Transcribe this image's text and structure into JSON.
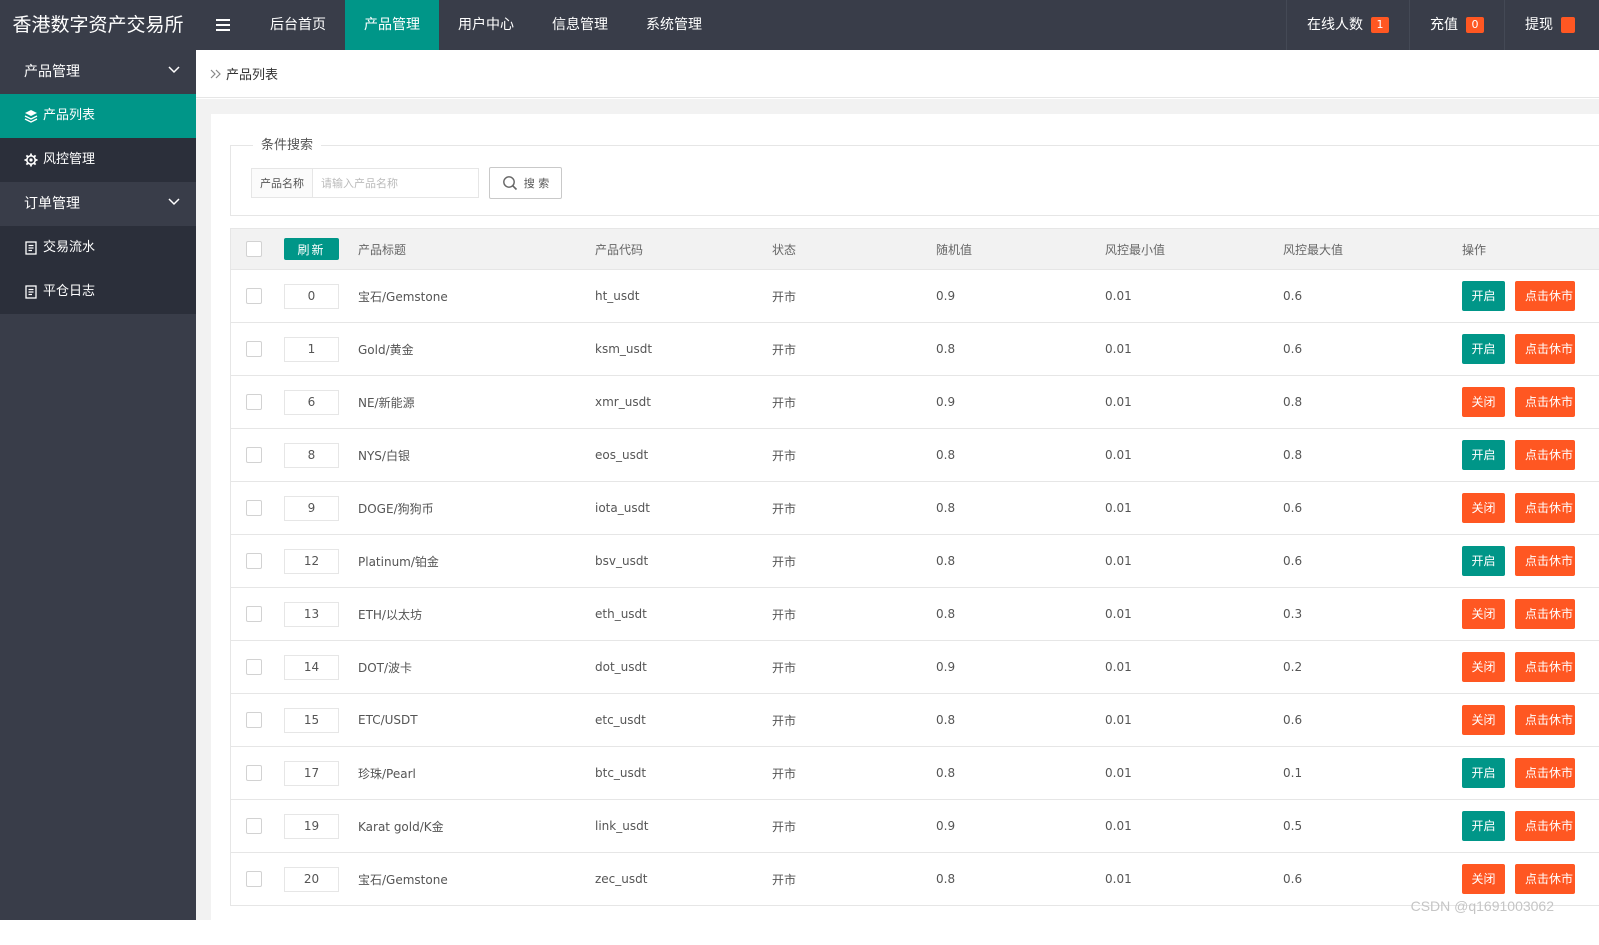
{
  "header": {
    "logo": "香港数字资产交易所",
    "nav": [
      {
        "label": "后台首页"
      },
      {
        "label": "产品管理"
      },
      {
        "label": "用户中心"
      },
      {
        "label": "信息管理"
      },
      {
        "label": "系统管理"
      }
    ],
    "active_nav": "产品管理",
    "right": [
      {
        "label": "在线人数",
        "count": "1"
      },
      {
        "label": "充值",
        "count": "0"
      },
      {
        "label": "提现",
        "count": ""
      }
    ]
  },
  "sidebar": {
    "groups": [
      {
        "label": "产品管理",
        "items": [
          {
            "label": "产品列表"
          },
          {
            "label": "风控管理"
          }
        ]
      },
      {
        "label": "订单管理",
        "items": [
          {
            "label": "交易流水"
          },
          {
            "label": "平仓日志"
          }
        ]
      }
    ]
  },
  "breadcrumb": {
    "current": "产品列表"
  },
  "search": {
    "legend": "条件搜索",
    "label": "产品名称",
    "placeholder": "请输入产品名称",
    "button": "搜 索"
  },
  "table": {
    "refresh": "刷新",
    "columns": [
      "产品标题",
      "产品代码",
      "状态",
      "随机值",
      "风控最小值",
      "风控最大值",
      "操作"
    ],
    "open_label": "开启",
    "close_label": "关闭",
    "action_label": "点击休市",
    "rows": [
      {
        "sort": "0",
        "title": "宝石/Gemstone",
        "code": "ht_usdt",
        "status": "开市",
        "random": "0.9",
        "min": "0.01",
        "max": "0.6",
        "toggle": "开启"
      },
      {
        "sort": "1",
        "title": "Gold/黄金",
        "code": "ksm_usdt",
        "status": "开市",
        "random": "0.8",
        "min": "0.01",
        "max": "0.6",
        "toggle": "开启"
      },
      {
        "sort": "6",
        "title": "NE/新能源",
        "code": "xmr_usdt",
        "status": "开市",
        "random": "0.9",
        "min": "0.01",
        "max": "0.8",
        "toggle": "关闭"
      },
      {
        "sort": "8",
        "title": "NYS/白银",
        "code": "eos_usdt",
        "status": "开市",
        "random": "0.8",
        "min": "0.01",
        "max": "0.8",
        "toggle": "开启"
      },
      {
        "sort": "9",
        "title": "DOGE/狗狗币",
        "code": "iota_usdt",
        "status": "开市",
        "random": "0.8",
        "min": "0.01",
        "max": "0.6",
        "toggle": "关闭"
      },
      {
        "sort": "12",
        "title": "Platinum/铂金",
        "code": "bsv_usdt",
        "status": "开市",
        "random": "0.8",
        "min": "0.01",
        "max": "0.6",
        "toggle": "开启"
      },
      {
        "sort": "13",
        "title": "ETH/以太坊",
        "code": "eth_usdt",
        "status": "开市",
        "random": "0.8",
        "min": "0.01",
        "max": "0.3",
        "toggle": "关闭"
      },
      {
        "sort": "14",
        "title": "DOT/波卡",
        "code": "dot_usdt",
        "status": "开市",
        "random": "0.9",
        "min": "0.01",
        "max": "0.2",
        "toggle": "关闭"
      },
      {
        "sort": "15",
        "title": "ETC/USDT",
        "code": "etc_usdt",
        "status": "开市",
        "random": "0.8",
        "min": "0.01",
        "max": "0.6",
        "toggle": "关闭"
      },
      {
        "sort": "17",
        "title": "珍珠/Pearl",
        "code": "btc_usdt",
        "status": "开市",
        "random": "0.8",
        "min": "0.01",
        "max": "0.1",
        "toggle": "开启"
      },
      {
        "sort": "19",
        "title": "Karat gold/K金",
        "code": "link_usdt",
        "status": "开市",
        "random": "0.9",
        "min": "0.01",
        "max": "0.5",
        "toggle": "开启"
      },
      {
        "sort": "20",
        "title": "宝石/Gemstone",
        "code": "zec_usdt",
        "status": "开市",
        "random": "0.8",
        "min": "0.01",
        "max": "0.6",
        "toggle": "关闭"
      }
    ]
  },
  "watermark": "CSDN @q1691003062",
  "colors": {
    "header": "#393d49",
    "accent": "#009688",
    "warn": "#ff5722",
    "sidebar_sub": "#2b2f3a"
  }
}
